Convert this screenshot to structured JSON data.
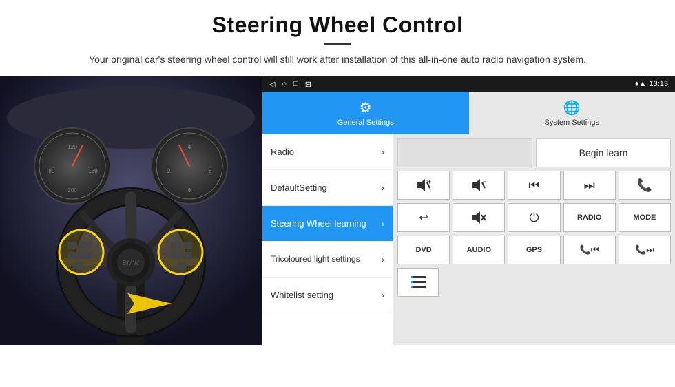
{
  "header": {
    "title": "Steering Wheel Control",
    "subtitle": "Your original car's steering wheel control will still work after installation of this all-in-one auto radio navigation system."
  },
  "status_bar": {
    "nav_icons": [
      "◁",
      "○",
      "□",
      "⊟"
    ],
    "right_icons": "♦ ▲",
    "time": "13:13"
  },
  "tabs": [
    {
      "label": "General Settings",
      "active": true,
      "icon": "⚙"
    },
    {
      "label": "System Settings",
      "active": false,
      "icon": "🌐"
    }
  ],
  "menu_items": [
    {
      "label": "Radio",
      "active": false
    },
    {
      "label": "DefaultSetting",
      "active": false
    },
    {
      "label": "Steering Wheel learning",
      "active": true
    },
    {
      "label": "Tricoloured light settings",
      "active": false
    },
    {
      "label": "Whitelist setting",
      "active": false
    }
  ],
  "begin_learn_label": "Begin learn",
  "control_buttons_row1": [
    {
      "label": "🔊+",
      "type": "icon"
    },
    {
      "label": "🔊−",
      "type": "icon"
    },
    {
      "label": "⏮",
      "type": "icon"
    },
    {
      "label": "⏭",
      "type": "icon"
    },
    {
      "label": "📞",
      "type": "icon"
    }
  ],
  "control_buttons_row2": [
    {
      "label": "↩",
      "type": "icon"
    },
    {
      "label": "🔊✕",
      "type": "icon"
    },
    {
      "label": "⏻",
      "type": "icon"
    },
    {
      "label": "RADIO",
      "type": "text"
    },
    {
      "label": "MODE",
      "type": "text"
    }
  ],
  "control_buttons_row3": [
    {
      "label": "DVD",
      "type": "text"
    },
    {
      "label": "AUDIO",
      "type": "text"
    },
    {
      "label": "GPS",
      "type": "text"
    },
    {
      "label": "📞⏮",
      "type": "icon"
    },
    {
      "label": "📞⏭",
      "type": "icon"
    }
  ],
  "control_buttons_row4": [
    {
      "label": "≡",
      "type": "icon"
    }
  ]
}
